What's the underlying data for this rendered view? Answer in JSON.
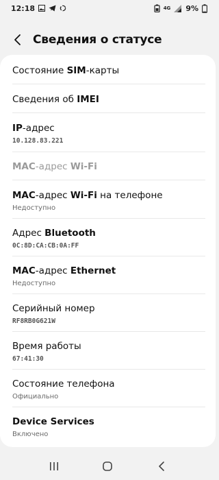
{
  "status_bar": {
    "time": "12:18",
    "network_label": "4G",
    "battery": "9%"
  },
  "header": {
    "title": "Сведения о статусе"
  },
  "items": [
    {
      "title_parts": [
        "Состояние ",
        "SIM",
        "-карты"
      ],
      "subtitle": ""
    },
    {
      "title_parts": [
        "Сведения об ",
        "IMEI",
        ""
      ],
      "subtitle": ""
    },
    {
      "title_parts": [
        "",
        "IP",
        "-адрес"
      ],
      "subtitle": "10.128.83.221"
    },
    {
      "title_parts": [
        "",
        "MAC",
        "-адрес ",
        "Wi-Fi"
      ],
      "subtitle": ""
    },
    {
      "title_parts": [
        "",
        "MAC",
        "-адрес ",
        "Wi-Fi",
        " на телефоне"
      ],
      "subtitle": "Недоступно"
    },
    {
      "title_parts": [
        "Адрес ",
        "Bluetooth"
      ],
      "subtitle": "0C:8D:CA:CB:0A:FF"
    },
    {
      "title_parts": [
        "",
        "MAC",
        "-адрес ",
        "Ethernet"
      ],
      "subtitle": "Недоступно"
    },
    {
      "title_parts": [
        "Серийный номер"
      ],
      "subtitle": "RF8RB0G621W"
    },
    {
      "title_parts": [
        "Время работы"
      ],
      "subtitle": "67:41:30"
    },
    {
      "title_parts": [
        "Состояние телефона"
      ],
      "subtitle": "Официально"
    },
    {
      "title_parts": [
        "",
        "Device Services"
      ],
      "subtitle": "Включено"
    }
  ],
  "colors": {
    "background": "#f2f2f2",
    "card": "#ffffff",
    "disabled_text": "#9a9a9a",
    "subtitle_text": "#6a6a6a"
  }
}
